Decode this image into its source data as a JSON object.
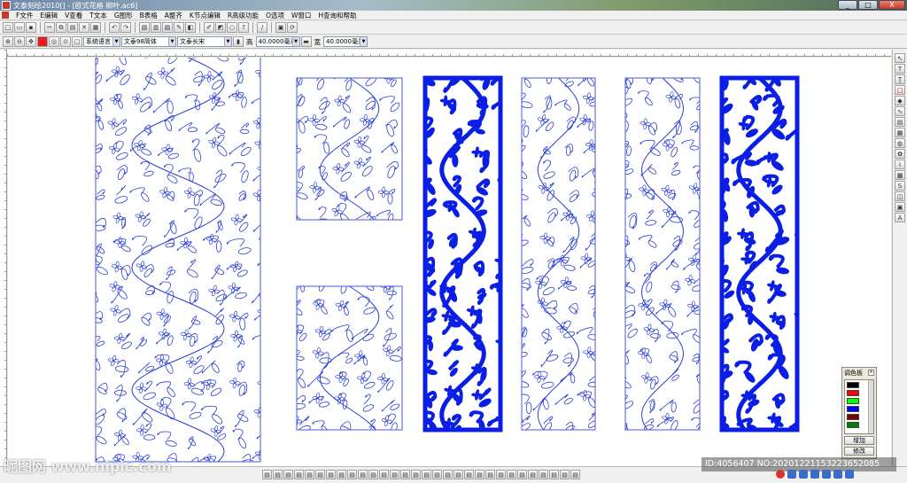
{
  "window": {
    "title": "文泰刻绘2010[] - [欧式花格 柳叶.ac6]",
    "controls": [
      "_",
      "□",
      "X"
    ]
  },
  "menu": {
    "items": [
      "F文件",
      "E编辑",
      "V查看",
      "T文本",
      "G图形",
      "B表格",
      "A整齐",
      "K节点编辑",
      "R高级功能",
      "O选项",
      "W窗口",
      "H查询和帮助"
    ]
  },
  "toolbar2": {
    "language": "系统语言",
    "font_cn": "文泰98简体",
    "font_en": "文泰长宋",
    "height_label": "高",
    "height_value": "40.0000毫米",
    "width_label": "宽",
    "width_value": "40.0000毫米"
  },
  "palette": {
    "title": "调色板",
    "colors": [
      "#000000",
      "#ff0000",
      "#00ff00",
      "#0000ff",
      "#800000",
      "#008000"
    ],
    "add_label": "增加",
    "edit_label": "修改"
  },
  "overlay": {
    "watermark": "昵图网 www.nipic.com",
    "id_text": "ID:4056407 NO:20201221153223652085"
  },
  "colors": {
    "outline": "#2a3fd6",
    "fill": "#0a1ee6",
    "frame": "#4a5ad8"
  },
  "icons": {
    "tray": [
      "sogou-input-icon",
      "chinese-mode-icon",
      "punctuation-icon",
      "mic-icon",
      "keyboard-icon",
      "shirt-icon",
      "grid-icon"
    ]
  }
}
